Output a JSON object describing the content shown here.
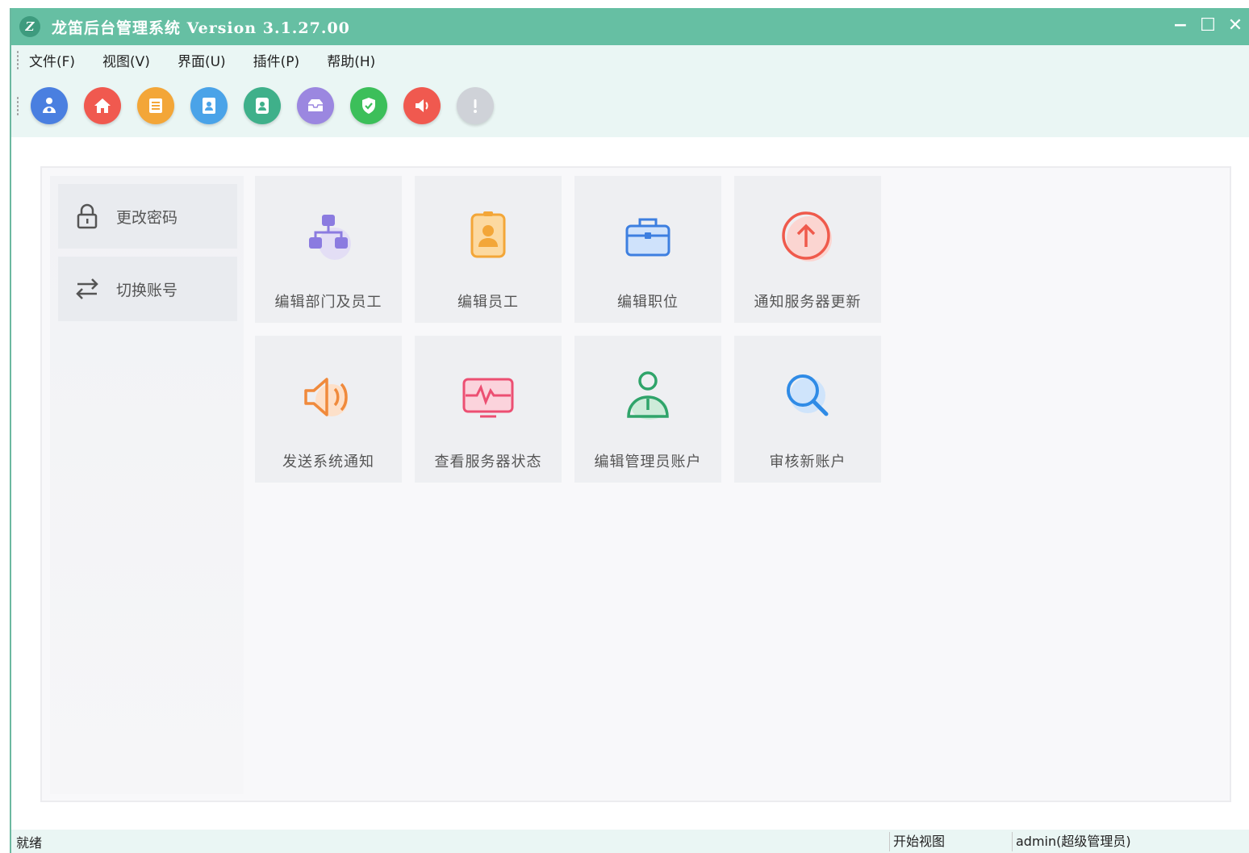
{
  "window": {
    "logo_glyph": "Z",
    "title": "龙笛后台管理系统 Version 3.1.27.00",
    "minimize_glyph": "−",
    "maximize_glyph": "☐",
    "close_glyph": "✕"
  },
  "menu": {
    "items": [
      {
        "label": "文件(F)"
      },
      {
        "label": "视图(V)"
      },
      {
        "label": "界面(U)"
      },
      {
        "label": "插件(P)"
      },
      {
        "label": "帮助(H)"
      }
    ]
  },
  "toolbar": {
    "icons": [
      {
        "name": "org-icon",
        "color": "#4a7fe0"
      },
      {
        "name": "home-icon",
        "color": "#f0594f"
      },
      {
        "name": "list-icon",
        "color": "#f3a638"
      },
      {
        "name": "contact-card-icon",
        "color": "#4aa3e8"
      },
      {
        "name": "user-card-icon",
        "color": "#3fb08a"
      },
      {
        "name": "inbox-icon",
        "color": "#9b87e0"
      },
      {
        "name": "shield-check-icon",
        "color": "#3cbf5a"
      },
      {
        "name": "speaker-icon",
        "color": "#f0594f"
      },
      {
        "name": "alert-icon",
        "color": "#cfd2d8"
      }
    ]
  },
  "sidebar": {
    "items": [
      {
        "label": "更改密码",
        "icon": "lock-icon"
      },
      {
        "label": "切换账号",
        "icon": "switch-arrows-icon"
      }
    ]
  },
  "tiles": {
    "row1": [
      {
        "label": "编辑部门及员工",
        "icon": "org-chart-icon"
      },
      {
        "label": "编辑员工",
        "icon": "badge-icon"
      },
      {
        "label": "编辑职位",
        "icon": "briefcase-icon"
      },
      {
        "label": "通知服务器更新",
        "icon": "upload-circle-icon"
      }
    ],
    "row2": [
      {
        "label": "发送系统通知",
        "icon": "speaker-icon"
      },
      {
        "label": "查看服务器状态",
        "icon": "monitor-pulse-icon"
      },
      {
        "label": "编辑管理员账户",
        "icon": "admin-user-icon"
      },
      {
        "label": "审核新账户",
        "icon": "search-icon"
      }
    ]
  },
  "status": {
    "ready": "就绪",
    "view": "开始视图",
    "user": "admin(超级管理员)"
  },
  "colors": {
    "title_bar": "#66bfa3",
    "menu_bar": "#eaf6f4"
  }
}
